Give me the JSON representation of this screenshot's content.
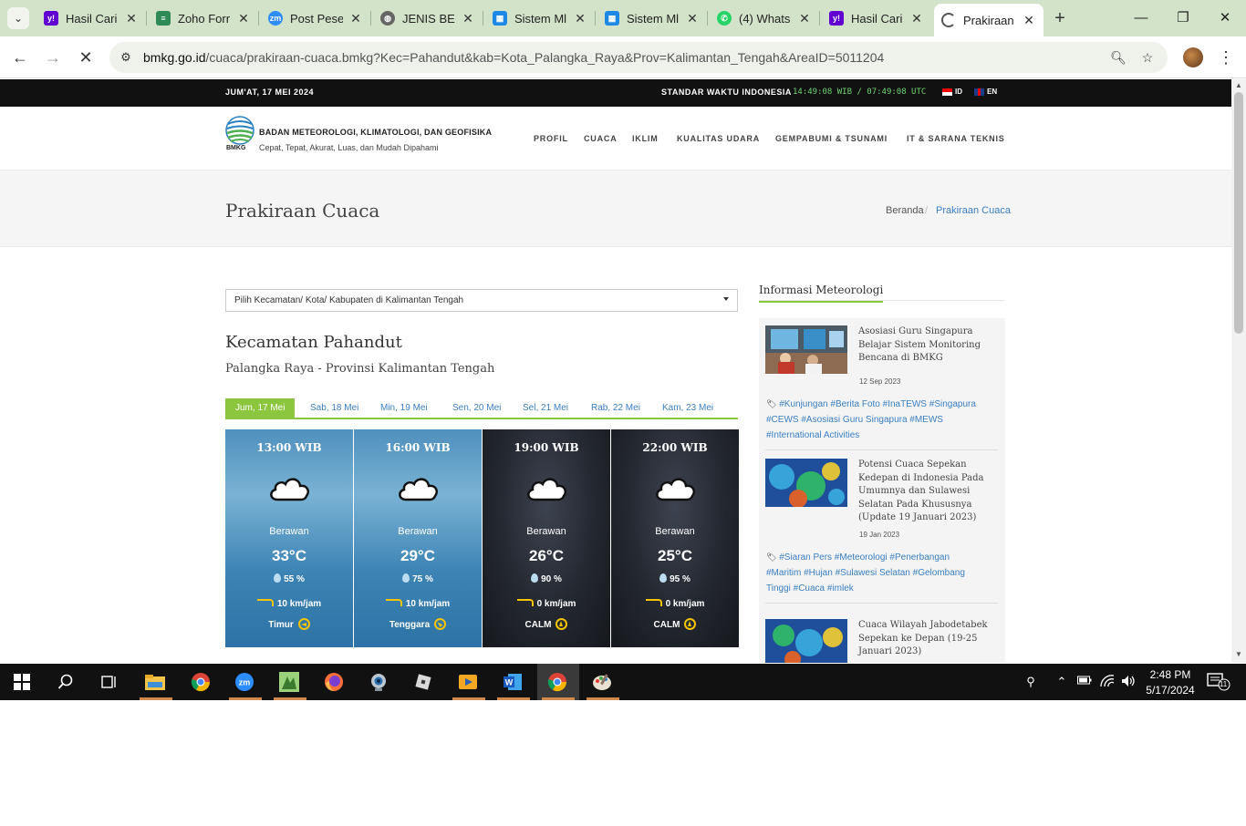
{
  "browser": {
    "tabs": [
      {
        "title": "Hasil Cari",
        "favicon": "yahoo-icon",
        "color": "#6001d2"
      },
      {
        "title": "Zoho Forr",
        "favicon": "zoho-forms-icon",
        "color": "#2e8b57"
      },
      {
        "title": "Post Pese",
        "favicon": "zoom-icon",
        "color": "#2d8cff"
      },
      {
        "title": "JENIS BEN",
        "favicon": "globe-icon",
        "color": "#555555"
      },
      {
        "title": "Sistem Ml",
        "favicon": "sites-icon",
        "color": "#1e88e5"
      },
      {
        "title": "Sistem Ml",
        "favicon": "sites-icon",
        "color": "#1e88e5"
      },
      {
        "title": "(4) Whats",
        "favicon": "whatsapp-icon",
        "color": "#25d366"
      },
      {
        "title": "Hasil Cari",
        "favicon": "yahoo-icon",
        "color": "#6001d2"
      },
      {
        "title": "Prakiraan",
        "favicon": "loading-icon",
        "color": "#555555"
      }
    ],
    "url_host": "bmkg.go.id",
    "url_path": "/cuaca/prakiraan-cuaca.bmkg?Kec=Pahandut&kab=Kota_Palangka_Raya&Prov=Kalimantan_Tengah&AreaID=5011204"
  },
  "site": {
    "date": "JUM'AT, 17 MEI 2024",
    "standard_time_label": "STANDAR WAKTU INDONESIA",
    "clock": "14:49:08 WIB / 07:49:08 UTC",
    "lang_id": "ID",
    "lang_en": "EN",
    "logo_text": "BMKG",
    "org_name": "BADAN METEOROLOGI, KLIMATOLOGI, DAN GEOFISIKA",
    "org_tagline": "Cepat, Tepat, Akurat, Luas, dan Mudah Dipahami",
    "nav": [
      "PROFIL",
      "CUACA",
      "IKLIM",
      "KUALITAS UDARA",
      "GEMPABUMI & TSUNAMI",
      "IT & SARANA TEKNIS"
    ]
  },
  "page": {
    "title": "Prakiraan Cuaca",
    "breadcrumb_home": "Beranda",
    "breadcrumb_sep": "/",
    "breadcrumb_current": "Prakiraan Cuaca",
    "select_label": "Pilih Kecamatan/ Kota/ Kabupaten di Kalimantan Tengah",
    "kecamatan": "Kecamatan Pahandut",
    "location": "Palangka Raya - Provinsi Kalimantan Tengah",
    "days": [
      "Jum, 17 Mei",
      "Sab, 18 Mei",
      "Min, 19 Mei",
      "Sen, 20 Mei",
      "Sel, 21 Mei",
      "Rab, 22 Mei",
      "Kam, 23 Mei"
    ],
    "forecasts": [
      {
        "time": "13:00 WIB",
        "condition": "Berawan",
        "temp": "33°C",
        "humidity": "55 %",
        "wind": "10 km/jam",
        "direction": "Timur",
        "theme": "day"
      },
      {
        "time": "16:00 WIB",
        "condition": "Berawan",
        "temp": "29°C",
        "humidity": "75 %",
        "wind": "10 km/jam",
        "direction": "Tenggara",
        "theme": "day"
      },
      {
        "time": "19:00 WIB",
        "condition": "Berawan",
        "temp": "26°C",
        "humidity": "90 %",
        "wind": "0 km/jam",
        "direction": "CALM",
        "theme": "night"
      },
      {
        "time": "22:00 WIB",
        "condition": "Berawan",
        "temp": "25°C",
        "humidity": "95 %",
        "wind": "0 km/jam",
        "direction": "CALM",
        "theme": "night"
      }
    ]
  },
  "sidebar": {
    "title": "Informasi Meteorologi",
    "news": [
      {
        "title": "Asosiasi Guru Singapura Belajar Sistem Monitoring Bencana di BMKG",
        "date": "12 Sep 2023",
        "tags": "#Kunjungan #Berita Foto #InaTEWS #Singapura #CEWS #Asosiasi Guru Singapura #MEWS #International Activities"
      },
      {
        "title": "Potensi Cuaca Sepekan Kedepan di Indonesia Pada Umumnya dan Sulawesi Selatan Pada Khususnya (Update 19 Januari 2023)",
        "date": "19 Jan 2023",
        "tags": "#Siaran Pers #Meteorologi #Penerbangan #Maritim #Hujan #Sulawesi Selatan #Gelombang Tinggi #Cuaca #imlek"
      },
      {
        "title": "Cuaca Wilayah Jabodetabek Sepekan ke Depan (19-25 Januari 2023)",
        "date": "",
        "tags": ""
      }
    ]
  },
  "taskbar": {
    "time": "2:48 PM",
    "date": "5/17/2024",
    "notifications": "11"
  }
}
